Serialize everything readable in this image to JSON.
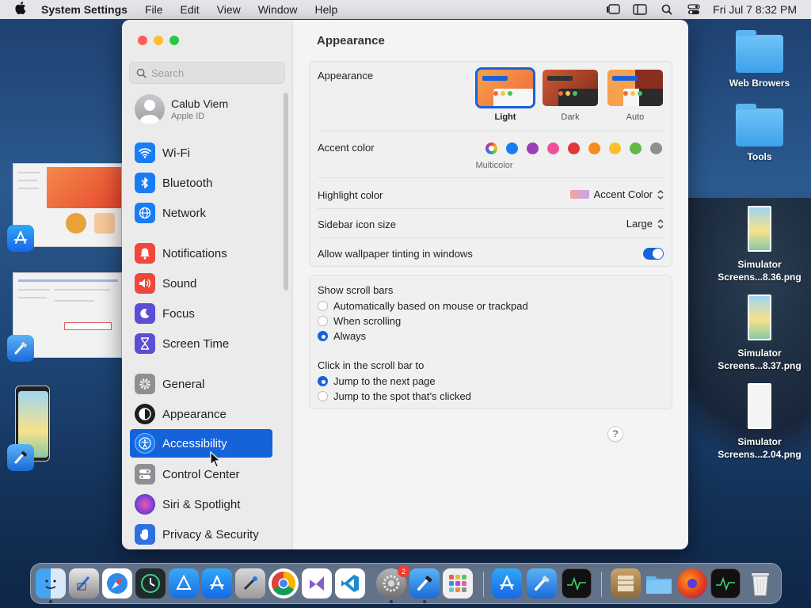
{
  "menubar": {
    "app": "System Settings",
    "items": [
      "File",
      "Edit",
      "View",
      "Window",
      "Help"
    ],
    "clock": "Fri Jul 7  8:32 PM"
  },
  "desktop": {
    "items": [
      {
        "label": "Web Browers"
      },
      {
        "label": "Tools"
      },
      {
        "label": "Simulator Screens...8.36.png"
      },
      {
        "label": "Simulator Screens...8.37.png"
      },
      {
        "label": "Simulator Screens...2.04.png"
      }
    ]
  },
  "sidebar": {
    "search_placeholder": "Search",
    "user": {
      "name": "Calub Viem",
      "sub": "Apple ID"
    },
    "items": [
      {
        "label": "Wi-Fi",
        "icon": "wifi-icon",
        "color": "#1a7cf5"
      },
      {
        "label": "Bluetooth",
        "icon": "bluetooth-icon",
        "color": "#1a7cf5"
      },
      {
        "label": "Network",
        "icon": "globe-icon",
        "color": "#1a7cf5"
      },
      {
        "label": "Notifications",
        "icon": "bell-icon",
        "color": "#f0473b"
      },
      {
        "label": "Sound",
        "icon": "speaker-icon",
        "color": "#f0473b"
      },
      {
        "label": "Focus",
        "icon": "moon-icon",
        "color": "#5b4fd6"
      },
      {
        "label": "Screen Time",
        "icon": "hourglass-icon",
        "color": "#5b4fd6"
      },
      {
        "label": "General",
        "icon": "gear-icon",
        "color": "#8e8e93"
      },
      {
        "label": "Appearance",
        "icon": "appearance-icon",
        "color": "#1c1c1e"
      },
      {
        "label": "Accessibility",
        "icon": "accessibility-icon",
        "color": "#1a7cf5"
      },
      {
        "label": "Control Center",
        "icon": "control-center-icon",
        "color": "#8e8e93"
      },
      {
        "label": "Siri & Spotlight",
        "icon": "siri-icon",
        "color": "#b03fd0"
      },
      {
        "label": "Privacy & Security",
        "icon": "hand-icon",
        "color": "#2f6fe0"
      }
    ]
  },
  "main": {
    "title": "Appearance",
    "appearance": {
      "label": "Appearance",
      "options": [
        {
          "label": "Light",
          "selected": true
        },
        {
          "label": "Dark",
          "selected": false
        },
        {
          "label": "Auto",
          "selected": false
        }
      ]
    },
    "accent": {
      "label": "Accent color",
      "selected_name": "Multicolor",
      "colors": [
        "#1a7cf5",
        "#9b3fb7",
        "#f0509b",
        "#e0393c",
        "#f78b1f",
        "#fbc02a",
        "#62ba46",
        "#8e8e93"
      ]
    },
    "highlight": {
      "label": "Highlight color",
      "value": "Accent Color"
    },
    "sidebar_icon": {
      "label": "Sidebar icon size",
      "value": "Large"
    },
    "tinting": {
      "label": "Allow wallpaper tinting in windows",
      "on": true
    },
    "scrollbars": {
      "label": "Show scroll bars",
      "options": [
        "Automatically based on mouse or trackpad",
        "When scrolling",
        "Always"
      ],
      "selected": 2
    },
    "click": {
      "label": "Click in the scroll bar to",
      "options": [
        "Jump to the next page",
        "Jump to the spot that’s clicked"
      ],
      "selected": 0
    },
    "help": "?"
  },
  "dock": {
    "badge": "2",
    "apps": [
      "finder-icon",
      "xcode-instruments-icon",
      "safari-icon",
      "time-machine-icon",
      "migration-icon",
      "app-store-icon",
      "utility-icon",
      "chrome-icon",
      "visual-studio-icon",
      "vscode-icon",
      "system-settings-icon",
      "xcode-beta-icon",
      "launchpad-icon",
      "app-store-2-icon",
      "xcode-icon",
      "activity-monitor-icon",
      "archive-icon",
      "downloads-folder-icon",
      "firefox-icon",
      "activity-monitor-2-icon",
      "trash-icon"
    ]
  }
}
